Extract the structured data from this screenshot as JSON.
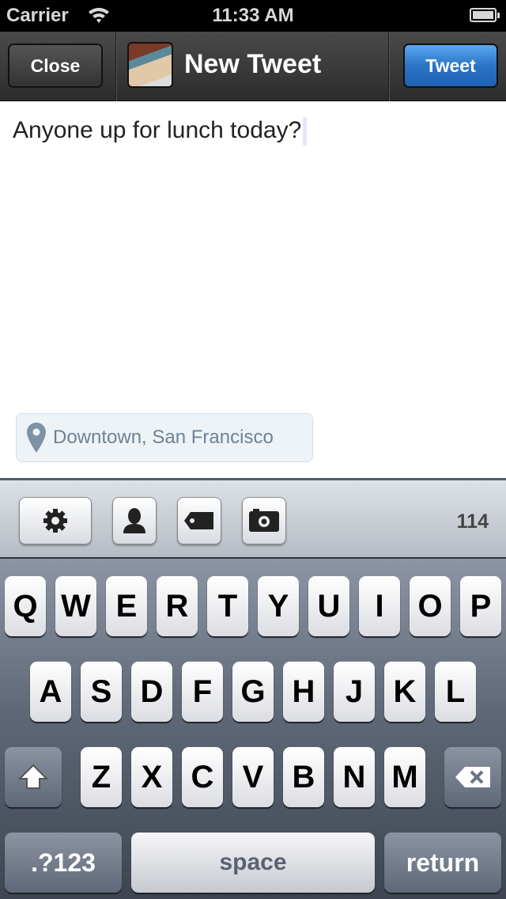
{
  "status_bar": {
    "carrier": "Carrier",
    "time": "11:33 AM",
    "battery_level": 1.0
  },
  "nav": {
    "close_label": "Close",
    "title": "New Tweet",
    "tweet_label": "Tweet",
    "tweet_color": "#2b74c6"
  },
  "compose": {
    "text": "Anyone up for lunch today?"
  },
  "location": {
    "label": "Downtown, San Francisco",
    "icon": "map-pin-icon"
  },
  "toolbar": {
    "icons": [
      "gear-icon",
      "person-icon",
      "tag-icon",
      "camera-icon"
    ],
    "char_count": "114"
  },
  "keyboard": {
    "rows": [
      [
        "Q",
        "W",
        "E",
        "R",
        "T",
        "Y",
        "U",
        "I",
        "O",
        "P"
      ],
      [
        "A",
        "S",
        "D",
        "F",
        "G",
        "H",
        "J",
        "K",
        "L"
      ],
      [
        "Z",
        "X",
        "C",
        "V",
        "B",
        "N",
        "M"
      ]
    ],
    "numbers_label": ".?123",
    "space_label": "space",
    "return_label": "return"
  }
}
